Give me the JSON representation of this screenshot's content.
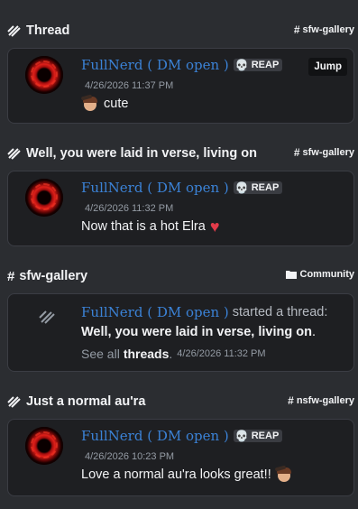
{
  "sections": [
    {
      "title": "Thread",
      "channel": "sfw-gallery",
      "author": "FullNerd ( DM open )",
      "tag": "REAP",
      "timestamp": "4/26/2026 11:37 PM",
      "message": "cute",
      "jump_label": "Jump"
    },
    {
      "title": "Well, you were laid in verse, living on",
      "channel": "sfw-gallery",
      "author": "FullNerd ( DM open )",
      "tag": "REAP",
      "timestamp": "4/26/2026 11:32 PM",
      "message": "Now that is a hot Elra"
    },
    {
      "title": "sfw-gallery",
      "channel": "Community",
      "author": "FullNerd ( DM open )",
      "verb": "started a thread:",
      "thread_name": "Well, you were laid in verse, living on",
      "see_all_prefix": "See all",
      "see_all_link": "threads",
      "timestamp": "4/26/2026 11:32 PM"
    },
    {
      "title": "Just a normal au'ra",
      "channel": "nsfw-gallery",
      "author": "FullNerd ( DM open )",
      "tag": "REAP",
      "timestamp": "4/26/2026 10:23 PM",
      "message": "Love a normal au'ra looks great!!"
    }
  ],
  "icons": {
    "thread": "thread-icon",
    "channel": "hash-icon",
    "category": "folder-icon",
    "tag": "skull-icon",
    "heart": "red-heart-emoji"
  },
  "colors": {
    "background": "#2b2d31",
    "card": "#1e1f22",
    "author": "#3b82d6",
    "heart": "#e23b4a"
  }
}
